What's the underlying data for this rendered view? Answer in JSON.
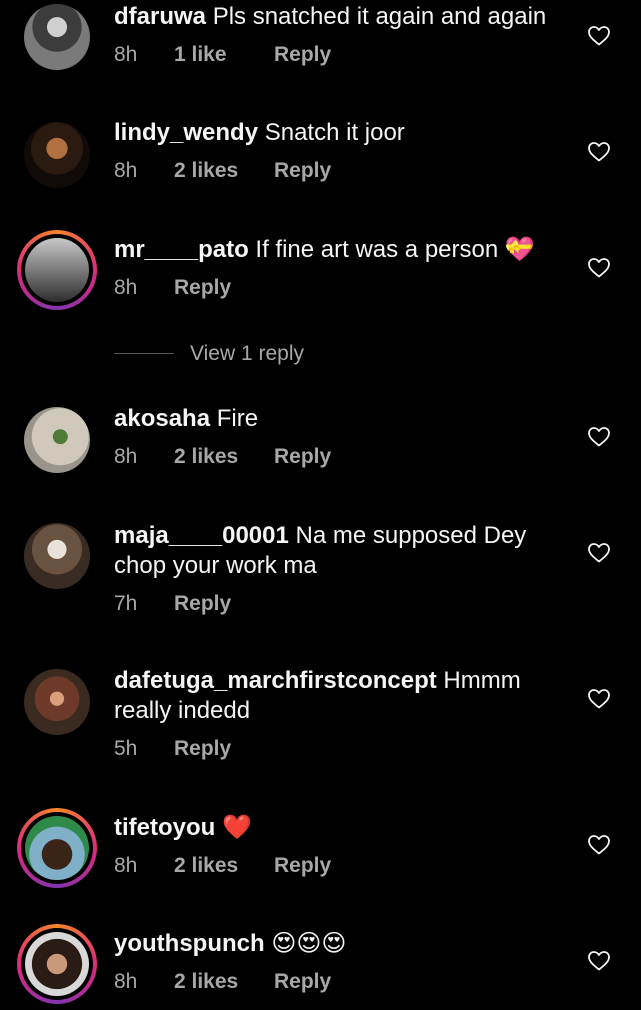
{
  "colors": {
    "background": "#000000",
    "text": "#f5f5f5",
    "secondary": "#a8a8a8",
    "heart_emoji": "#e0245e",
    "story_ring": "#dd2a7b"
  },
  "icons": {
    "like": "heart-outline-icon"
  },
  "comments": [
    {
      "username": "dfaruwa",
      "text": "Pls snatched it again and again",
      "time": "8h",
      "likes": "1 like",
      "reply": "Reply"
    },
    {
      "username": "lindy_wendy",
      "text": "Snatch it joor",
      "time": "8h",
      "likes": "2 likes",
      "reply": "Reply"
    },
    {
      "username": "mr____pato",
      "text": "If fine art was a person",
      "emoji": "💝",
      "time": "8h",
      "reply": "Reply",
      "view_replies": "View 1 reply"
    },
    {
      "username": "akosaha",
      "text": "Fire",
      "time": "8h",
      "likes": "2 likes",
      "reply": "Reply"
    },
    {
      "username": "maja____00001",
      "text": "Na me supposed Dey",
      "text_line2": "chop your work ma",
      "time": "7h",
      "reply": "Reply"
    },
    {
      "username": "dafetuga_marchfirstconcept",
      "text": "Hmmm",
      "text_line2": "really indedd",
      "time": "5h",
      "reply": "Reply"
    },
    {
      "username": "tifetoyou",
      "emoji": "❤️",
      "time": "8h",
      "likes": "2 likes",
      "reply": "Reply"
    },
    {
      "username": "youthspunch",
      "emoji": "😍😍😍",
      "time": "8h",
      "likes": "2 likes",
      "reply": "Reply"
    }
  ]
}
